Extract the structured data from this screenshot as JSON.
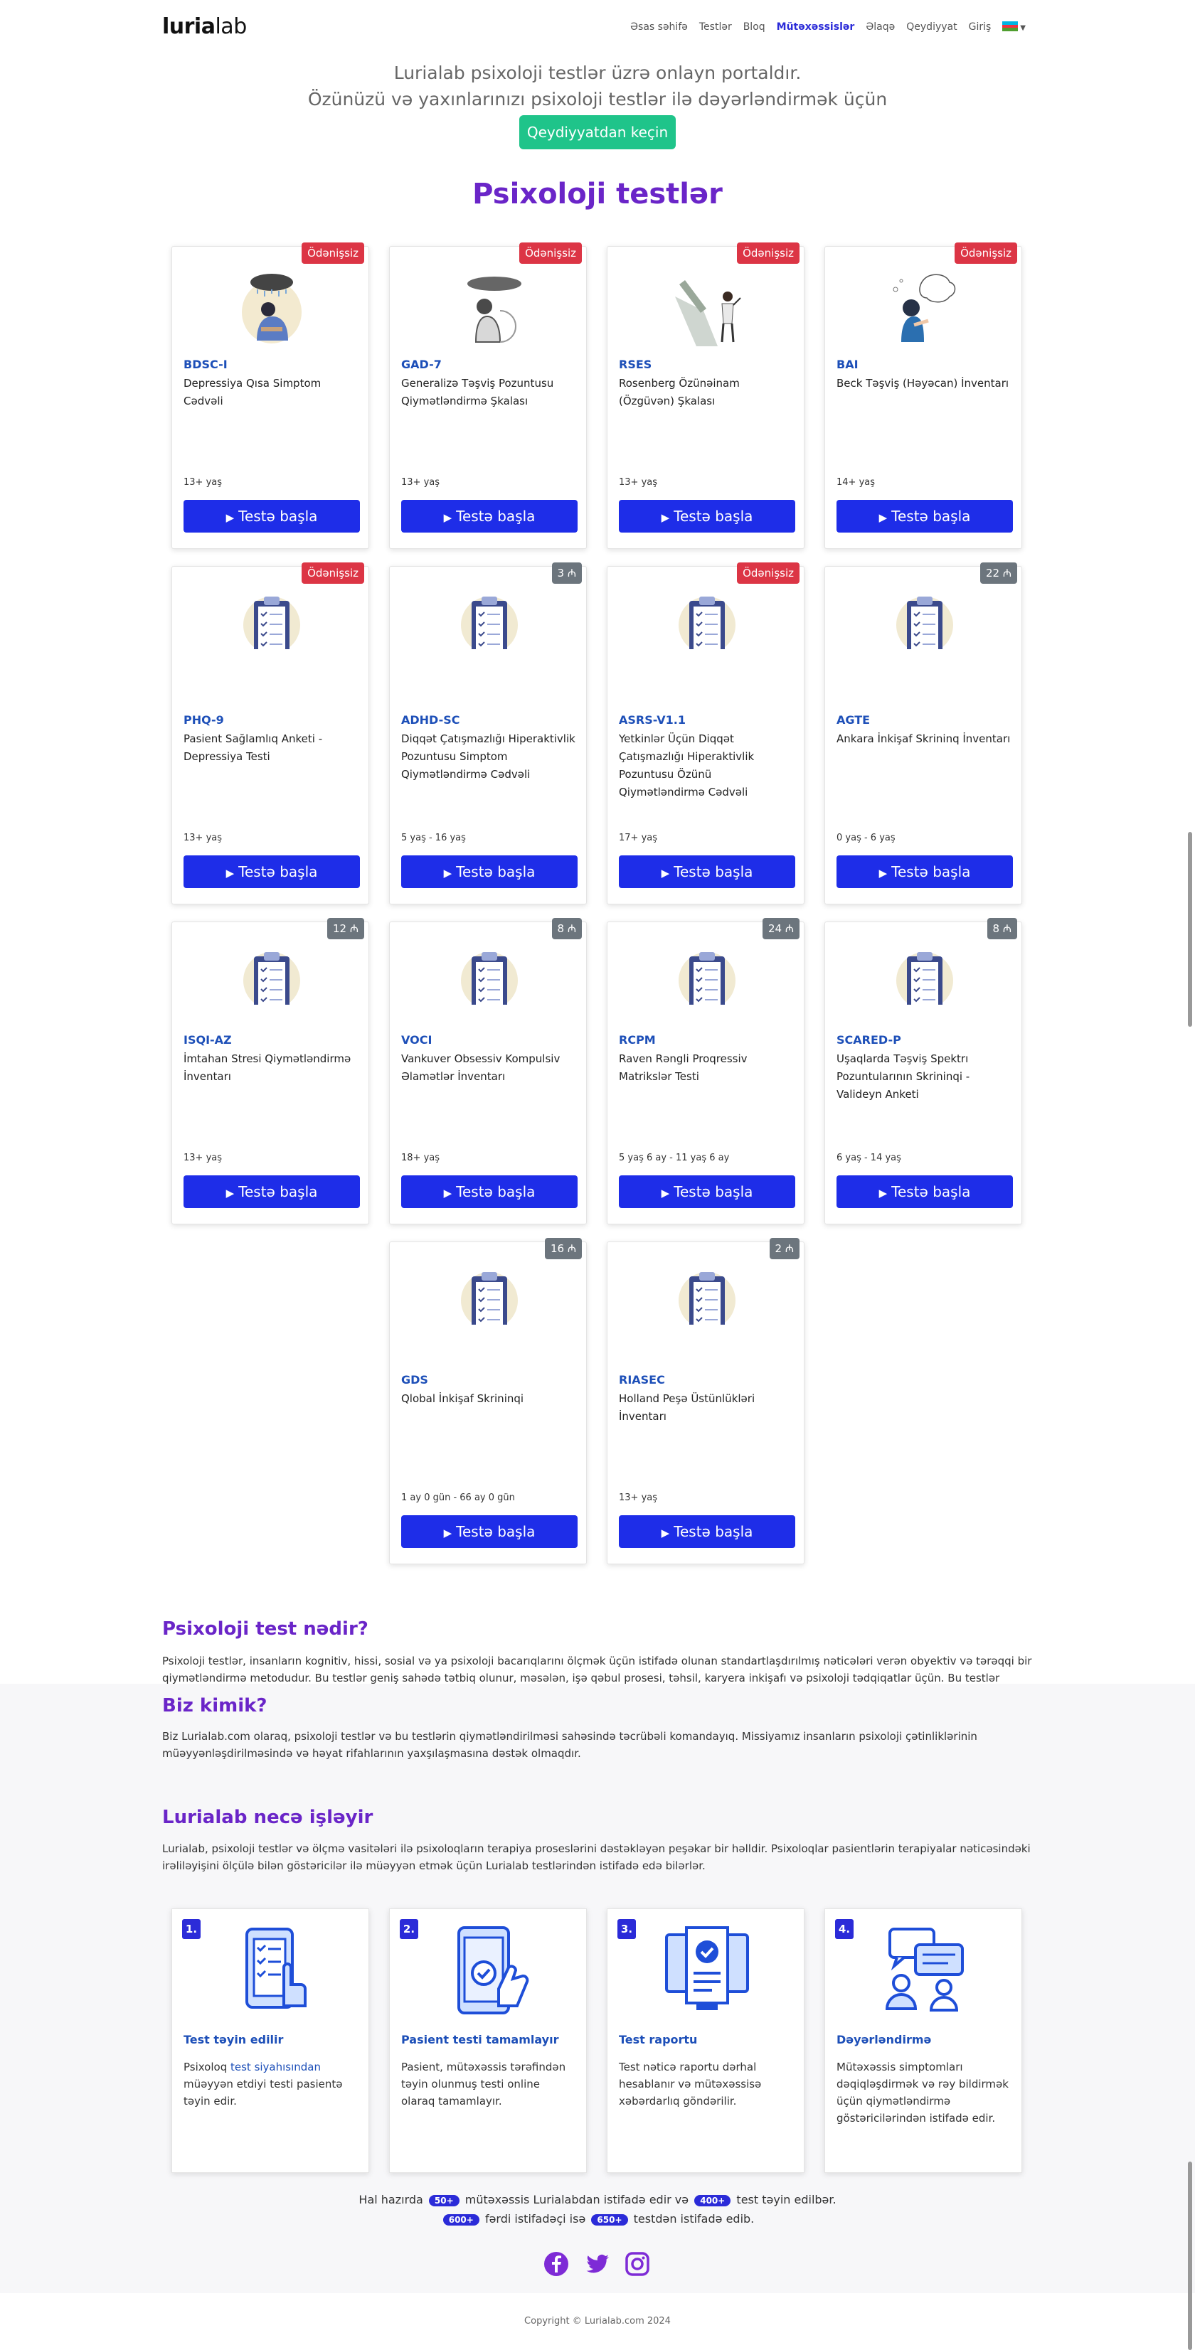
{
  "nav": {
    "logo_bold": "luria",
    "logo_light": "lab",
    "items": [
      {
        "label": "Əsas səhifə",
        "active": false
      },
      {
        "label": "Testlər",
        "active": false
      },
      {
        "label": "Bloq",
        "active": false
      },
      {
        "label": "Mütəxəssislər",
        "active": true
      },
      {
        "label": "Əlaqə",
        "active": false
      },
      {
        "label": "Qeydiyyat",
        "active": false
      },
      {
        "label": "Giriş",
        "active": false
      }
    ],
    "language_icon": "azerbaijan-flag-icon"
  },
  "hero": {
    "line1": "Lurialab psixoloji testlər üzrə onlayn portaldır.",
    "line2": "Özünüzü və yaxınlarınızı psixoloji testlər ilə dəyərləndirmək üçün",
    "button": "Qeydiyyatdan keçin"
  },
  "tests_section": {
    "title": "Psixoloji testlər",
    "start_label": "Testə başla",
    "tests": [
      {
        "code": "BDSC-I",
        "name": "Depressiya Qısa Simptom Cədvəli",
        "age": "13+ yaş",
        "badge": "Ödənişsiz",
        "badge_type": "free",
        "icon": "sad-person-cloud-icon"
      },
      {
        "code": "GAD-7",
        "name": "Generalizə Təşviş Pozuntusu Qiymətləndirmə Şkalası",
        "age": "13+ yaş",
        "badge": "Ödənişsiz",
        "badge_type": "free",
        "icon": "anxious-person-cloud-icon"
      },
      {
        "code": "RSES",
        "name": "Rosenberg Özünəinam (Özgüvən) Şkalası",
        "age": "13+ yaş",
        "badge": "Ödənişsiz",
        "badge_type": "free",
        "icon": "self-esteem-shadow-icon"
      },
      {
        "code": "BAI",
        "name": "Beck Təşviş (Həyəcan) İnventarı",
        "age": "14+ yaş",
        "badge": "Ödənişsiz",
        "badge_type": "free",
        "icon": "worried-person-thoughts-icon"
      },
      {
        "code": "PHQ-9",
        "name": "Pasient Sağlamlıq Anketi - Depressiya Testi",
        "age": "13+ yaş",
        "badge": "Ödənişsiz",
        "badge_type": "free",
        "icon": "clipboard-icon"
      },
      {
        "code": "ADHD-SC",
        "name": "Diqqət Çatışmazlığı Hiperaktivlik Pozuntusu Simptom Qiymətləndirmə Cədvəli",
        "age": "5 yaş - 16 yaş",
        "badge": "3 ₼",
        "badge_type": "paid",
        "icon": "clipboard-icon"
      },
      {
        "code": "ASRS-V1.1",
        "name": "Yetkinlər Üçün Diqqət Çatışmazlığı Hiperaktivlik Pozuntusu Özünü Qiymətləndirmə Cədvəli",
        "age": "17+ yaş",
        "badge": "Ödənişsiz",
        "badge_type": "free",
        "icon": "clipboard-icon"
      },
      {
        "code": "AGTE",
        "name": "Ankara İnkişaf Skrininq İnventarı",
        "age": "0 yaş - 6 yaş",
        "badge": "22 ₼",
        "badge_type": "paid",
        "icon": "clipboard-icon"
      },
      {
        "code": "ISQI-AZ",
        "name": "İmtahan Stresi Qiymətləndirmə İnventarı",
        "age": "13+ yaş",
        "badge": "12 ₼",
        "badge_type": "paid",
        "icon": "clipboard-icon"
      },
      {
        "code": "VOCI",
        "name": "Vankuver Obsessiv Kompulsiv Əlamətlər İnventarı",
        "age": "18+ yaş",
        "badge": "8 ₼",
        "badge_type": "paid",
        "icon": "clipboard-icon"
      },
      {
        "code": "RCPM",
        "name": "Raven Rəngli Proqressiv Matrikslər Testi",
        "age": "5 yaş 6 ay - 11 yaş 6 ay",
        "badge": "24 ₼",
        "badge_type": "paid",
        "icon": "clipboard-icon"
      },
      {
        "code": "SCARED-P",
        "name": "Uşaqlarda Təşviş Spektrı Pozuntularının Skrininqi - Valideyn Anketi",
        "age": "6 yaş - 14 yaş",
        "badge": "8 ₼",
        "badge_type": "paid",
        "icon": "clipboard-icon"
      },
      {
        "code": "GDS",
        "name": "Qlobal İnkişaf Skrininqi",
        "age": "1 ay 0 gün - 66 ay 0 gün",
        "badge": "16 ₼",
        "badge_type": "paid",
        "icon": "clipboard-icon"
      },
      {
        "code": "RIASEC",
        "name": "Holland Peşə Üstünlükləri İnventarı",
        "age": "13+ yaş",
        "badge": "2 ₼",
        "badge_type": "paid",
        "icon": "clipboard-icon"
      }
    ]
  },
  "what_is": {
    "title": "Psixoloji test nədir?",
    "text": "Psixoloji testlər, insanların kognitiv, hissi, sosial və ya psixoloji bacarıqlarını ölçmək üçün istifadə olunan standartlaşdırılmış nəticələri verən obyektiv və tərəqqi bir qiymətləndirmə metodudur. Bu testlər geniş sahədə tətbiq olunur, məsələn, işə qəbul prosesi, təhsil, karyera inkişafı və psixoloji tədqiqatlar üçün. Bu testlər müxtəlif"
  },
  "who_we_are": {
    "title": "Biz kimik?",
    "text": "Biz Lurialab.com olaraq, psixoloji testlər və bu testlərin qiymətləndirilməsi sahəsində təcrübəli komandayıq. Missiyamız insanların psixoloji çətinliklərinin müəyyənləşdirilməsində və həyat rifahlarının yaxşılaşmasına dəstək olmaqdır."
  },
  "how_it_works": {
    "title": "Lurialab necə işləyir",
    "text": "Lurialab, psixoloji testlər və ölçmə vasitələri ilə psixoloqların terapiya proseslərini dəstəkləyən peşəkar bir həlldir. Psixoloqlar pasientlərin terapiyalar nəticəsindəki irəliləyişini ölçülə bilən göstəricilər ilə müəyyən etmək üçün Lurialab testlərindən istifadə edə bilərlər.",
    "steps": [
      {
        "num": "1.",
        "title": "Test təyin edilir",
        "text_before": "Psixoloq ",
        "link": "test siyahısından",
        "text_after": " müəyyən etdiyi testi pasientə təyin edir.",
        "icon": "tablet-checklist-hand-icon"
      },
      {
        "num": "2.",
        "title": "Pasient testi tamamlayır",
        "text_before": "Pasient, mütəxəssis tərəfindən təyin olunmuş testi online olaraq tamamlayır.",
        "link": "",
        "text_after": "",
        "icon": "phone-tap-check-icon"
      },
      {
        "num": "3.",
        "title": "Test raportu",
        "text_before": "Test nəticə raportu dərhal hesablanır və mütəxəssisə xəbərdarlıq göndərilir.",
        "link": "",
        "text_after": "",
        "icon": "monitor-report-check-icon"
      },
      {
        "num": "4.",
        "title": "Dəyərləndirmə",
        "text_before": "Mütəxəssis simptomları dəqiqləşdirmək və rəy bildirmək üçün qiymətləndirmə göstəricilərindən istifadə edir.",
        "link": "",
        "text_after": "",
        "icon": "chat-people-icon"
      }
    ]
  },
  "stats": {
    "t1": "Hal hazırda",
    "specialists": "50+",
    "t2": "mütəxəssis Lurialabdan istifadə edir və",
    "assigned": "400+",
    "t3": "test təyin edilbər.",
    "users": "600+",
    "t4": "fərdi istifadəçi isə",
    "tests_used": "650+",
    "t5": "testdən istifadə edib."
  },
  "social": [
    "facebook-icon",
    "twitter-icon",
    "instagram-icon"
  ],
  "footer": {
    "copyright": "Copyright © Lurialab.com 2024"
  },
  "colors": {
    "brand": "#2b2bd8",
    "accent_green": "#1fc48a",
    "title_purple": "#6a25c8",
    "free_badge": "#dc3545",
    "paid_badge": "#6c757d"
  }
}
